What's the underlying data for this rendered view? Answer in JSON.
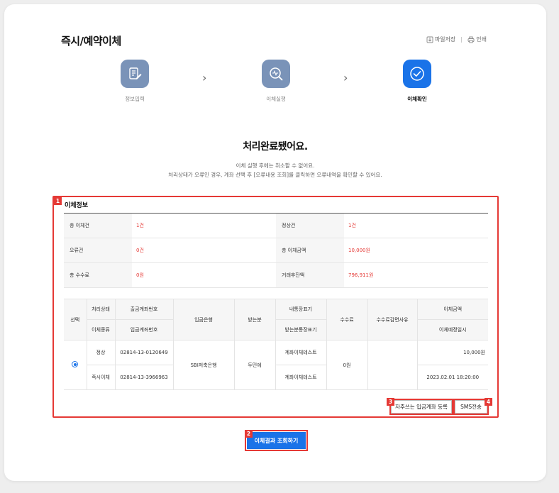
{
  "page": {
    "title": "즉시/예약이체",
    "save_file": "파일저장",
    "print": "인쇄"
  },
  "steps": [
    {
      "label": "정보입력",
      "icon": "document-edit-icon",
      "color": "#7a93b8"
    },
    {
      "label": "이체실행",
      "icon": "search-transfer-icon",
      "color": "#7a93b8"
    },
    {
      "label": "이체확인",
      "icon": "check-circle-icon",
      "color": "#1a73e8"
    }
  ],
  "result": {
    "title": "처리완료됐어요.",
    "desc1": "이체 실행 후에는 취소할 수 없어요.",
    "desc2": "처리상태가 오류인 경우, 계좌 선택 후 [오류내용 조회]를 클릭하면 오류내역을 확인할 수 있어요."
  },
  "section": {
    "title": "이체정보",
    "badges": [
      "1",
      "2",
      "3",
      "4"
    ]
  },
  "summary": {
    "rows": [
      [
        {
          "k": "총 이체건",
          "v": "1건"
        },
        {
          "k": "정상건",
          "v": "1건"
        }
      ],
      [
        {
          "k": "오류건",
          "v": "0건"
        },
        {
          "k": "총 이체금액",
          "v": "10,000원"
        }
      ],
      [
        {
          "k": "총 수수료",
          "v": "0원"
        },
        {
          "k": "거래후잔액",
          "v": "796,911원"
        }
      ]
    ]
  },
  "table": {
    "headers": {
      "select": "선택",
      "status": "처리상태",
      "type": "이체종류",
      "out_acct": "출금계좌번호",
      "in_acct": "입금계좌번호",
      "bank": "입금은행",
      "receiver": "받는분",
      "my_memo": "내통장표기",
      "recv_memo": "받는분통장표기",
      "fee": "수수료",
      "fee_reason": "수수료감면사유",
      "amount": "이체금액",
      "scheduled": "이체예정일시"
    },
    "row": {
      "status": "정상",
      "type": "즉시이체",
      "out_acct": "02814-13-0120649",
      "in_acct": "02814-13-3966963",
      "bank": "SBI저축은행",
      "receiver": "두민에",
      "my_memo": "계좌이체테스트",
      "recv_memo": "계좌이체테스트",
      "fee": "0원",
      "fee_reason": "",
      "amount": "10,000원",
      "scheduled": "2023.02.01 18:20:00"
    }
  },
  "buttons": {
    "favorite": "자주쓰는 입금계좌 등록",
    "sms": "SMS전송",
    "inquiry": "이체결과 조회하기"
  }
}
